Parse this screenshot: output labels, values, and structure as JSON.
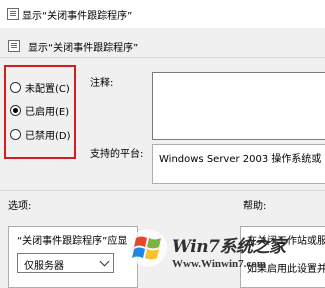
{
  "window": {
    "title": "显示“关闭事件跟踪程序”"
  },
  "header": {
    "title": "显示“关闭事件跟踪程序”"
  },
  "state": {
    "options": [
      {
        "label": "未配置(C)",
        "checked": false
      },
      {
        "label": "已启用(E)",
        "checked": true
      },
      {
        "label": "已禁用(D)",
        "checked": false
      }
    ]
  },
  "comment": {
    "label": "注释:"
  },
  "platform": {
    "label": "支持的平台:",
    "value": "Windows Server 2003 操作系统或"
  },
  "options_section": {
    "label": "选项:",
    "text": "“关闭事件跟踪程序”应显",
    "select_value": "仅服务器"
  },
  "help_section": {
    "label": "帮助:",
    "lines": [
      "在关闭工作站或服",
      "",
      "如果启用此设置并"
    ]
  },
  "watermark": {
    "brand": "Win7系统之家",
    "url": "Www.Winwin7.com"
  },
  "colors": {
    "highlight_border": "#d31d1d",
    "background": "#f0f0f0"
  }
}
